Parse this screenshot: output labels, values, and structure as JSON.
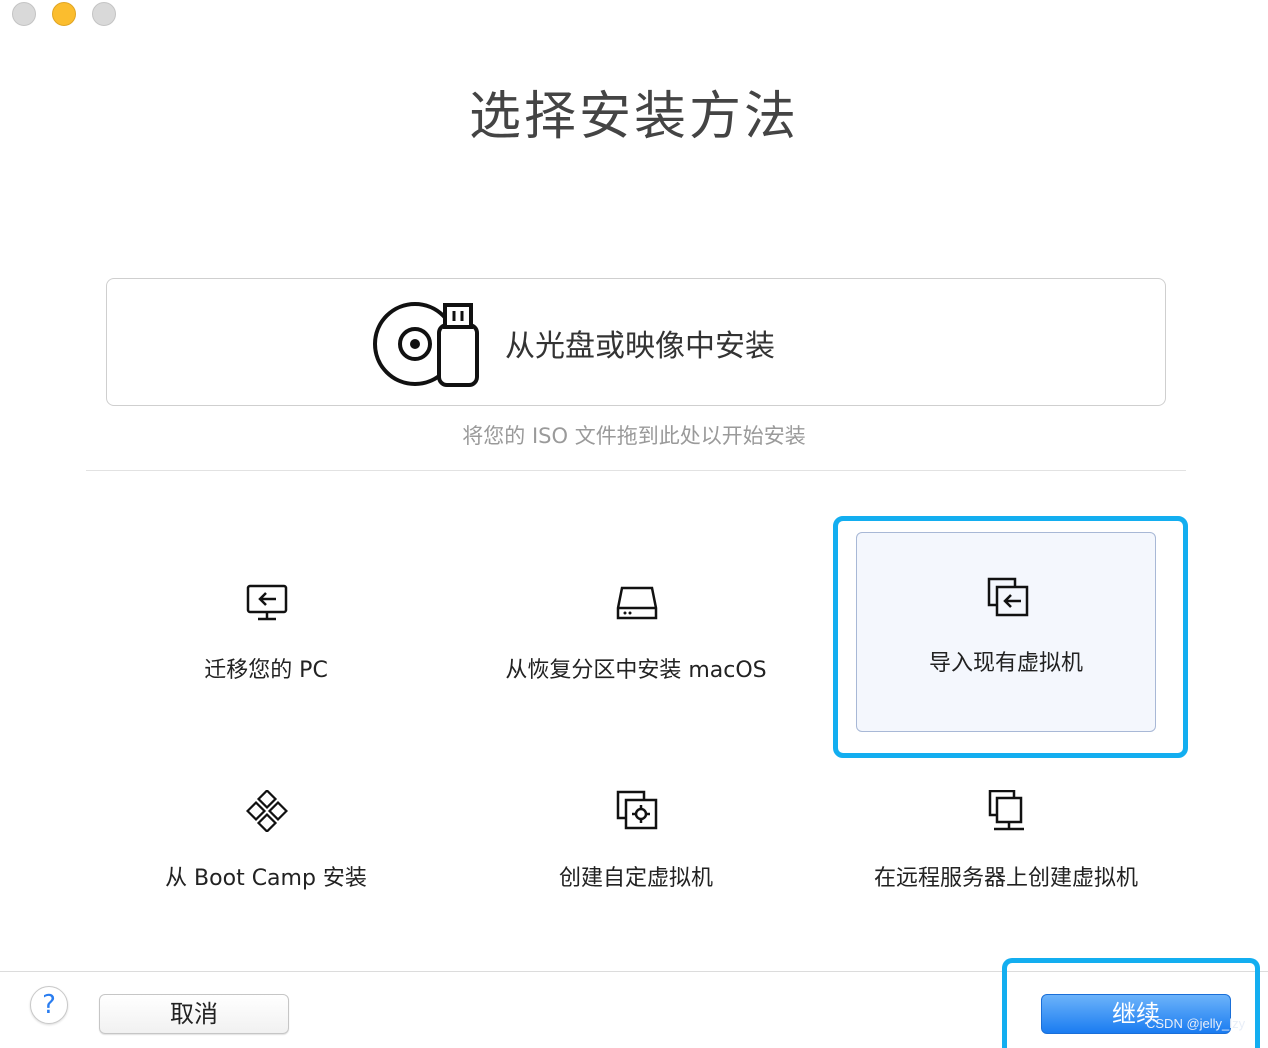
{
  "window": {
    "title": "选择安装方法"
  },
  "disc_option": {
    "label": "从光盘或映像中安装",
    "hint": "将您的 ISO 文件拖到此处以开始安装"
  },
  "options": [
    {
      "label": "迁移您的 PC",
      "icon": "migrate-pc-icon"
    },
    {
      "label": "从恢复分区中安装 macOS",
      "icon": "hard-disk-icon"
    },
    {
      "label": "导入现有虚拟机",
      "icon": "import-vm-icon",
      "selected": true
    },
    {
      "label": "从 Boot Camp 安装",
      "icon": "boot-camp-icon"
    },
    {
      "label": "创建自定虚拟机",
      "icon": "custom-vm-icon"
    },
    {
      "label": "在远程服务器上创建虚拟机",
      "icon": "remote-server-icon"
    }
  ],
  "footer": {
    "help": "?",
    "cancel": "取消",
    "continue": "继续"
  },
  "watermark": "CSDN @jelly_lzy",
  "colors": {
    "accent_blue": "#1a7cf1",
    "highlight_frame": "#13aef0",
    "selected_bg": "#f4f7fd"
  }
}
